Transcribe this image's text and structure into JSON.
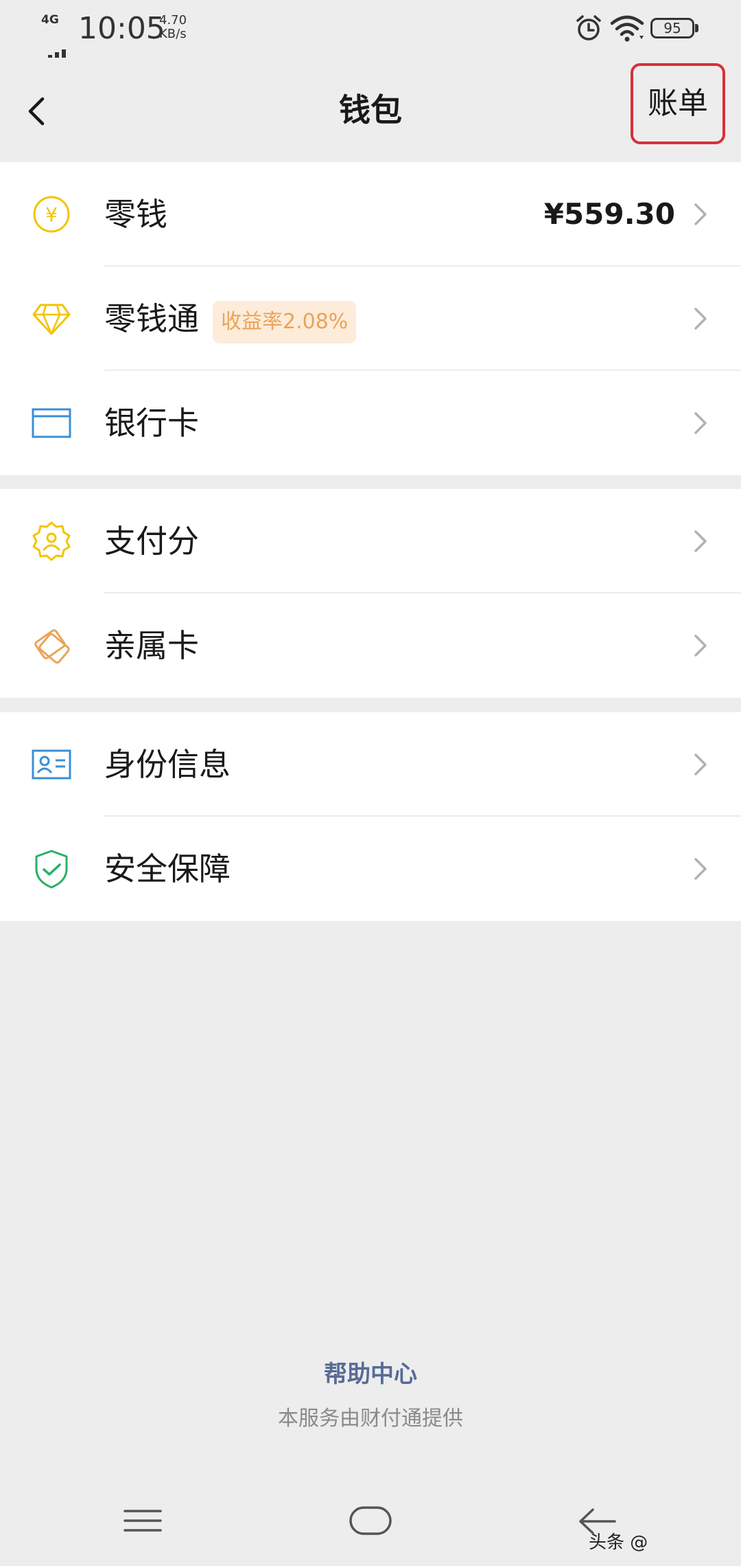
{
  "status_bar": {
    "network": "4G",
    "time": "10:05",
    "speed_value": "4.70",
    "speed_unit": "KB/s",
    "battery": "95"
  },
  "nav": {
    "title": "钱包",
    "bill_label": "账单",
    "highlight_color": "#d6303a"
  },
  "sections": [
    {
      "items": [
        {
          "label": "零钱",
          "icon": "yuan-coin-icon",
          "value": "¥559.30",
          "icon_color": "#f2c400"
        },
        {
          "label": "零钱通",
          "icon": "diamond-icon",
          "badge": "收益率2.08%",
          "icon_color": "#f2c400"
        },
        {
          "label": "银行卡",
          "icon": "bank-card-icon",
          "icon_color": "#3b8fd6"
        }
      ]
    },
    {
      "items": [
        {
          "label": "支付分",
          "icon": "credit-score-icon",
          "icon_color": "#f2c400"
        },
        {
          "label": "亲属卡",
          "icon": "family-card-icon",
          "icon_color": "#e9a45a"
        }
      ]
    },
    {
      "items": [
        {
          "label": "身份信息",
          "icon": "id-card-icon",
          "icon_color": "#3b8fd6"
        },
        {
          "label": "安全保障",
          "icon": "shield-check-icon",
          "icon_color": "#2bae67"
        }
      ]
    }
  ],
  "footer": {
    "help_center": "帮助中心",
    "provided_by": "本服务由财付通提供"
  },
  "watermark": "头条 @"
}
